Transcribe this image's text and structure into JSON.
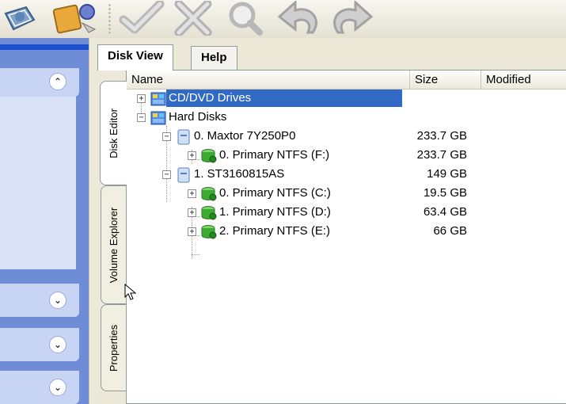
{
  "toolbar": {
    "buttons": [
      {
        "name": "basket-icon"
      },
      {
        "name": "wizard-icon"
      },
      {
        "name": "apply-check-icon"
      },
      {
        "name": "discard-x-icon"
      },
      {
        "name": "magnifier-icon"
      },
      {
        "name": "undo-icon"
      },
      {
        "name": "redo-icon"
      }
    ]
  },
  "tabs": [
    "Disk View",
    "Help"
  ],
  "side_tabs": [
    "Disk Editor",
    "Volume Explorer",
    "Properties"
  ],
  "columns": [
    "Name",
    "Size",
    "Modified"
  ],
  "tree": [
    {
      "label": "CD/DVD Drives",
      "size": "",
      "selected": true
    },
    {
      "label": "Hard Disks",
      "size": ""
    },
    {
      "label": "0. Maxtor 7Y250P0",
      "size": "233.7 GB"
    },
    {
      "label": "0. Primary NTFS (F:)",
      "size": "233.7 GB"
    },
    {
      "label": "1. ST3160815AS",
      "size": "149 GB"
    },
    {
      "label": "0. Primary NTFS (C:)",
      "size": "19.5 GB"
    },
    {
      "label": "1. Primary NTFS (D:)",
      "size": "63.4 GB"
    },
    {
      "label": "2. Primary NTFS (E:)",
      "size": "66 GB"
    }
  ],
  "colors": {
    "selection": "#316ac5",
    "nav_pane": "#6e8dd6",
    "nav_section": "#c7d4f3"
  }
}
